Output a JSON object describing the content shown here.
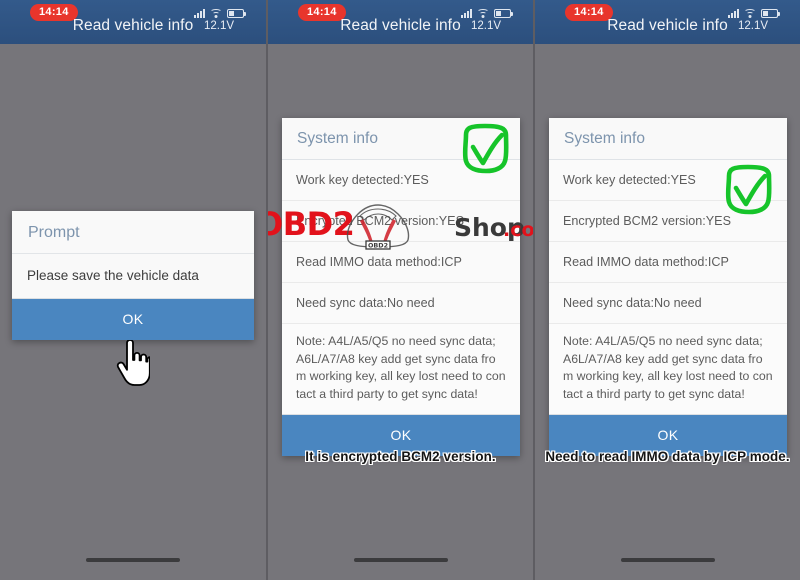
{
  "statusbar": {
    "time": "14:14",
    "title": "Read vehicle info",
    "voltage": "12.1V",
    "icons": {
      "signal": "signal-bars-icon",
      "wifi": "wifi-icon",
      "battery": "battery-icon"
    }
  },
  "panel1": {
    "dialog": {
      "title": "Prompt",
      "message": "Please save the vehicle data",
      "ok_label": "OK"
    },
    "cursor": "hand-pointer-cursor",
    "caption": ""
  },
  "panel2": {
    "dialog": {
      "title": "System info",
      "rows": [
        "Work key detected:YES",
        "Encrypted BCM2 version:YES",
        "Read IMMO data method:ICP",
        "Need sync data:No need"
      ],
      "note_lines": [
        "Note: A4L/A5/Q5 no need sync data;",
        "A6L/A7/A8 key add get sync data fro",
        "m working key, all key lost need to con",
        "tact a third party to get sync data!"
      ],
      "ok_label": "OK"
    },
    "annotation": "green-check-mark",
    "caption": "It is encrypted BCM2 version."
  },
  "panel3": {
    "dialog": {
      "title": "System info",
      "rows": [
        "Work key detected:YES",
        "Encrypted BCM2 version:YES",
        "Read IMMO data method:ICP",
        "Need sync data:No need"
      ],
      "note_lines": [
        "Note: A4L/A5/Q5 no need sync data;",
        "A6L/A7/A8 key add get sync data fro",
        "m working key, all key lost need to con",
        "tact a third party to get sync data!"
      ],
      "ok_label": "OK"
    },
    "annotation": "green-check-mark",
    "caption": "Need to read IMMO data by ICP mode."
  },
  "watermark": {
    "brand": "OBD2",
    "shop": "Shop",
    "tld": ".co.uk",
    "badge": "OBD2"
  },
  "colors": {
    "statusbar_blue": "#2f5380",
    "accent_blue": "#4a86c0",
    "time_badge_red": "#e8352c",
    "annotation_green": "#16c42a",
    "watermark_red": "#e2121b",
    "background_gray": "#76757a"
  }
}
